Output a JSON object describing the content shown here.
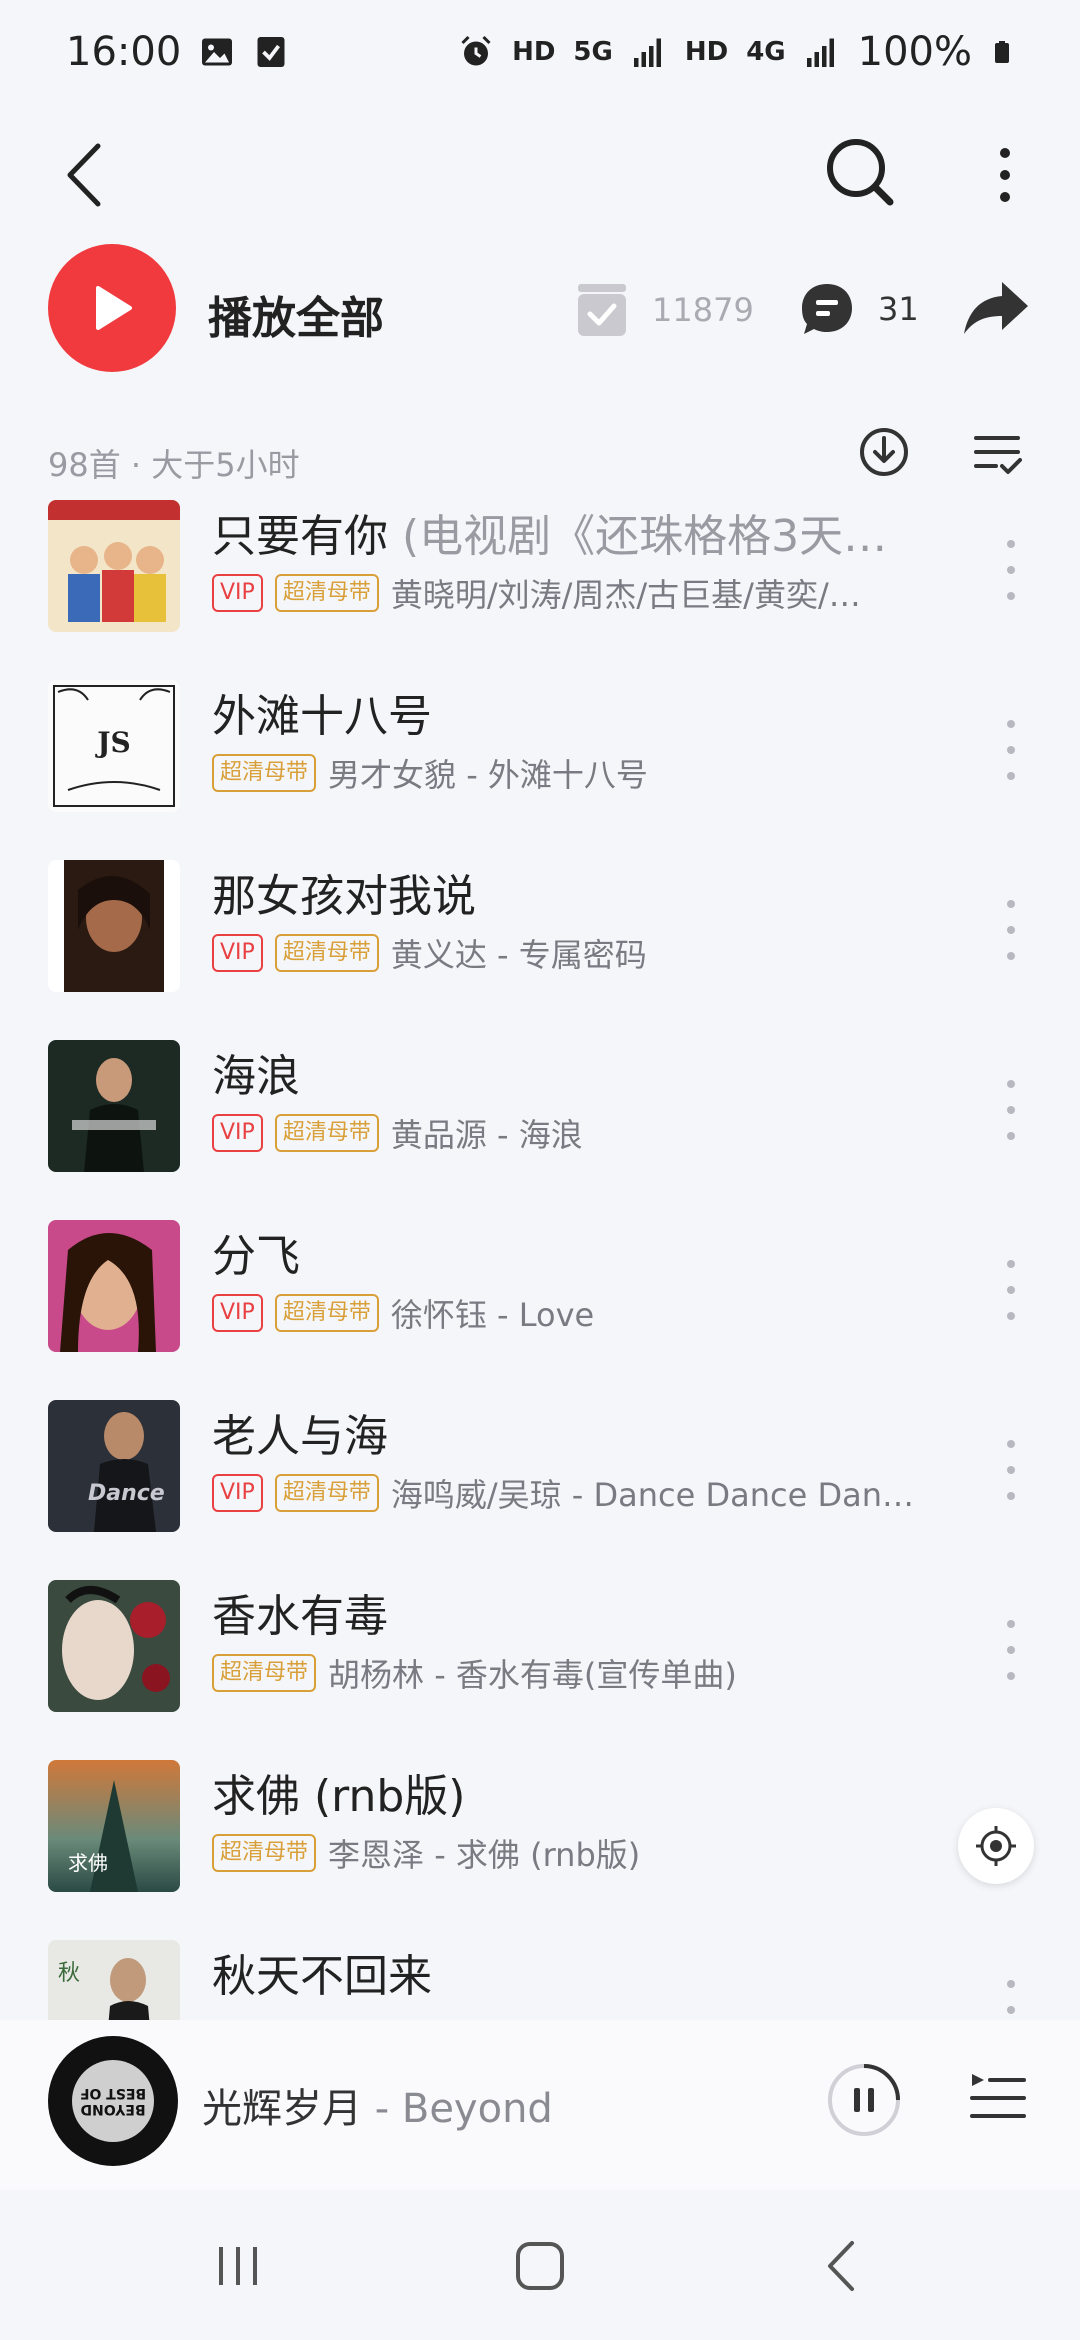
{
  "status_bar": {
    "time": "16:00",
    "network_left": "HD",
    "network_5g": "5G",
    "network_right": "HD",
    "network_4g": "4G",
    "battery": "100%"
  },
  "toolbar": {
    "back_icon": "chevron-left-icon",
    "search_icon": "search-icon",
    "more_icon": "more-vertical-icon"
  },
  "playall": {
    "label": "播放全部",
    "collect_count": "11879",
    "comment_count": "31"
  },
  "list_meta": "98首 · 大于5小时",
  "songs": [
    {
      "title": "只要有你",
      "title_extra": " (电视剧《还珠格格3天…",
      "vip": "VIP",
      "hq": "超清母带",
      "artist": "黄晓明/刘涛/周杰/古巨基/黄奕/…"
    },
    {
      "title": "外滩十八号",
      "title_extra": "",
      "vip": "",
      "hq": "超清母带",
      "artist": "男才女貌 - 外滩十八号"
    },
    {
      "title": "那女孩对我说",
      "title_extra": "",
      "vip": "VIP",
      "hq": "超清母带",
      "artist": "黄义达 - 专属密码"
    },
    {
      "title": "海浪",
      "title_extra": "",
      "vip": "VIP",
      "hq": "超清母带",
      "artist": "黄品源 - 海浪"
    },
    {
      "title": "分飞",
      "title_extra": "",
      "vip": "VIP",
      "hq": "超清母带",
      "artist": "徐怀钰 - Love"
    },
    {
      "title": "老人与海",
      "title_extra": "",
      "vip": "VIP",
      "hq": "超清母带",
      "artist": "海鸣威/吴琼 - Dance Dance Dan…"
    },
    {
      "title": "香水有毒",
      "title_extra": "",
      "vip": "",
      "hq": "超清母带",
      "artist": "胡杨林 - 香水有毒(宣传单曲)"
    },
    {
      "title": "求佛 (rnb版)",
      "title_extra": "",
      "vip": "",
      "hq": "超清母带",
      "artist": "李恩泽 - 求佛 (rnb版)"
    },
    {
      "title": "秋天不回来",
      "title_extra": "",
      "vip": "",
      "hq": "",
      "artist": ""
    }
  ],
  "mini_player": {
    "title": "光辉岁月",
    "separator": " - ",
    "artist": "Beyond",
    "disc_text": "BEYOND BEST OF"
  },
  "colors": {
    "accent_red": "#f03a3e",
    "vip_red": "#e94142",
    "hq_gold": "#d9a03a",
    "background": "#f5f6fa"
  }
}
